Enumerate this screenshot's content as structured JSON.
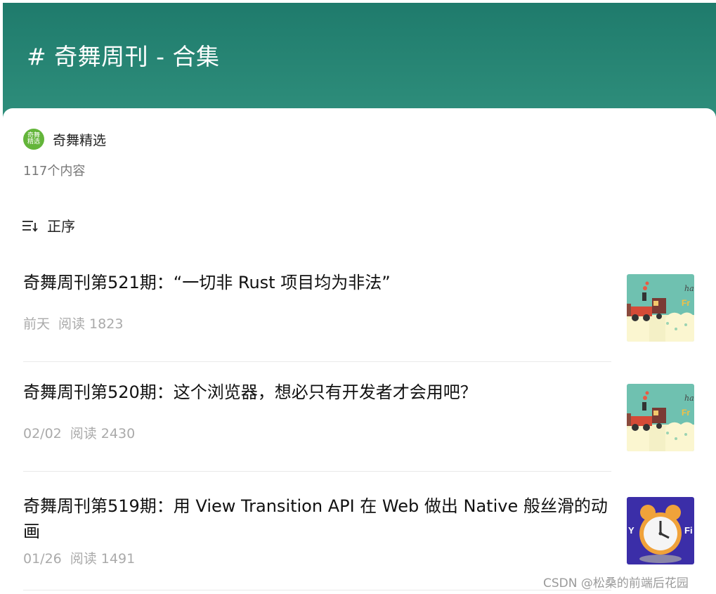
{
  "header": {
    "title": "# 奇舞周刊 - 合集"
  },
  "author": {
    "name": "奇舞精选",
    "avatar_text": "奇舞精选",
    "count": "117个内容"
  },
  "sort": {
    "label": "正序",
    "icon": "sort-icon"
  },
  "articles": [
    {
      "title": "奇舞周刊第521期：“一切非 Rust 项目均为非法”",
      "date": "前天",
      "reads": "阅读 1823",
      "thumbnail": "train-illustration"
    },
    {
      "title": "奇舞周刊第520期：这个浏览器，想必只有开发者才会用吧？",
      "date": "02/02",
      "reads": "阅读 2430",
      "thumbnail": "train-illustration"
    },
    {
      "title": "奇舞周刊第519期：用 View Transition API 在 Web 做出 Native 般丝滑的动画",
      "date": "01/26",
      "reads": "阅读 1491",
      "thumbnail": "alarm-clock"
    }
  ],
  "watermark": "CSDN @松桑的前端后花园",
  "colors": {
    "header": "#2a8773",
    "avatar": "#63b53a",
    "meta": "#aaaaaa"
  }
}
